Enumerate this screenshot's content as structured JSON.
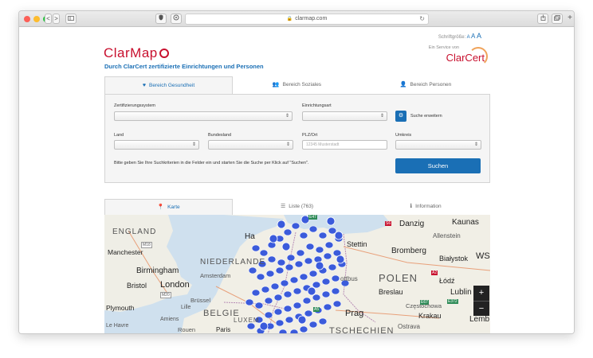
{
  "browser": {
    "url": "clarmap.com",
    "nav_back": "<",
    "nav_forward": ">"
  },
  "header": {
    "font_size_label": "Schriftgröße:",
    "font_size_a1": "A",
    "font_size_a2": "A",
    "font_size_a3": "A",
    "logo_text": "ClarMap",
    "tagline": "Durch ClarCert zertifizierte Einrichtungen und Personen",
    "service_label": "Ein Service von",
    "service_brand": "ClarCert"
  },
  "tabs": [
    {
      "label": "Bereich Gesundheit",
      "icon": "heart-icon"
    },
    {
      "label": "Bereich Soziales",
      "icon": "group-icon"
    },
    {
      "label": "Bereich Personen",
      "icon": "person-icon"
    }
  ],
  "form": {
    "zertifizierungssystem_label": "Zertifizierungssystem",
    "einrichtungsart_label": "Einrichtungsart",
    "expand_label": "Suche erweitern",
    "land_label": "Land",
    "bundesland_label": "Bundesland",
    "plz_label": "PLZ/Ort",
    "plz_placeholder": "12345 Musterstadt",
    "umkreis_label": "Umkreis",
    "hint": "Bitte geben Sie Ihre Suchkriterien in die Felder ein und starten Sie die Suche per Klick auf \"Suchen\".",
    "search_button": "Suchen"
  },
  "result_tabs": [
    {
      "label": "Karte",
      "icon": "map-marker-icon"
    },
    {
      "label": "Liste (763)",
      "icon": "list-icon"
    },
    {
      "label": "Information",
      "icon": "info-icon"
    }
  ],
  "map": {
    "labels": {
      "england": "ENGLAND",
      "manchester": "Manchester",
      "birmingham": "Birmingham",
      "bristol": "Bristol",
      "london": "London",
      "plymouth": "Plymouth",
      "amsterdam": "Amsterdam",
      "niederlande": "NIEDERLANDE",
      "bruessel": "Brüssel",
      "belgien": "BELGIE",
      "lille": "Lille",
      "rouen": "Rouen",
      "le_havre": "Le Havre",
      "amiens": "Amiens",
      "paris": "Paris",
      "luxembourg": "LUXEM",
      "hamburg": "Ha",
      "danzig": "Danzig",
      "kaunas": "Kaunas",
      "stettin": "Stettin",
      "allenstein": "Allenstein",
      "bromberg": "Bromberg",
      "bialystok": "Białystok",
      "ws": "WS",
      "polen": "POLEN",
      "lodz": "Łódź",
      "breslau": "Breslau",
      "lublin": "Lublin",
      "prag": "Prag",
      "czestochowa": "Częstochowa",
      "krakau": "Krakau",
      "ostrava": "Ostrava",
      "tschechien": "TSCHECHIEN",
      "lemberg": "Lemb",
      "cottbus": "ottbus",
      "m18": "M18",
      "m20": "M20",
      "a5": "A5",
      "s6": "S6",
      "a2": "A2",
      "e67": "E67",
      "e372": "E372",
      "e47": "E47"
    },
    "zoom_in": "+",
    "zoom_out": "−"
  },
  "colors": {
    "accent": "#1a6fb5",
    "brand_red": "#c8102e",
    "marker": "#3b5bdb"
  }
}
